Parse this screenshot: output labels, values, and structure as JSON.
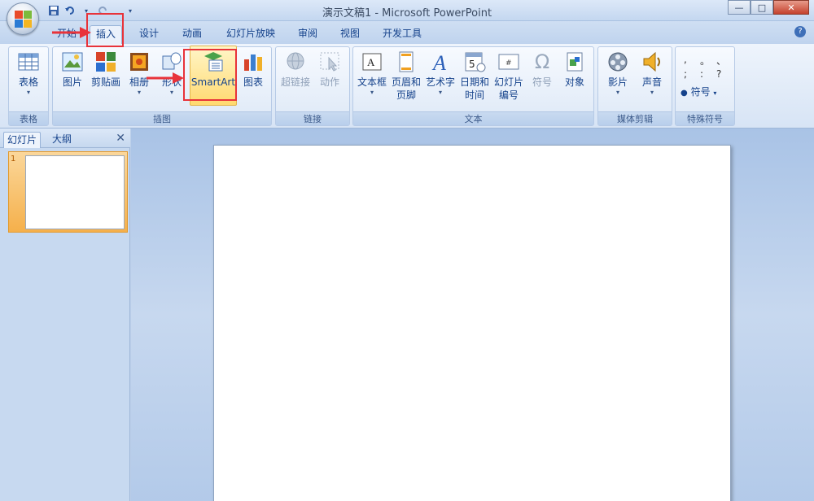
{
  "window": {
    "title": "演示文稿1 - Microsoft PowerPoint",
    "minimize": "—",
    "maximize": "□",
    "close": "✕"
  },
  "tabs": [
    {
      "label": "开始"
    },
    {
      "label": "插入"
    },
    {
      "label": "设计"
    },
    {
      "label": "动画"
    },
    {
      "label": "幻灯片放映"
    },
    {
      "label": "审阅"
    },
    {
      "label": "视图"
    },
    {
      "label": "开发工具"
    }
  ],
  "help": "?",
  "ribbon": {
    "groups": {
      "table": "表格",
      "illustrations": "插图",
      "links": "链接",
      "text": "文本",
      "media": "媒体剪辑",
      "special": "特殊符号"
    },
    "buttons": {
      "table": "表格",
      "picture": "图片",
      "clipart": "剪贴画",
      "album": "相册",
      "shapes": "形状",
      "smartart": "SmartArt",
      "chart": "图表",
      "hyperlink": "超链接",
      "action": "动作",
      "textbox": "文本框",
      "header1": "页眉和",
      "header2": "页脚",
      "wordart": "艺术字",
      "date1": "日期和",
      "date2": "时间",
      "slidenum1": "幻灯片",
      "slidenum2": "编号",
      "symbol": "符号",
      "object": "对象",
      "movie": "影片",
      "sound": "声音",
      "symbol2": "符号"
    },
    "special_symbols": [
      ",",
      "。",
      "、",
      ";",
      ":",
      "?"
    ]
  },
  "left_pane": {
    "tab_slides": "幻灯片",
    "tab_outline": "大纲",
    "close": "✕",
    "slide_number": "1"
  },
  "colors": {
    "annotation": "#e8333a",
    "accent": "#15428b"
  }
}
